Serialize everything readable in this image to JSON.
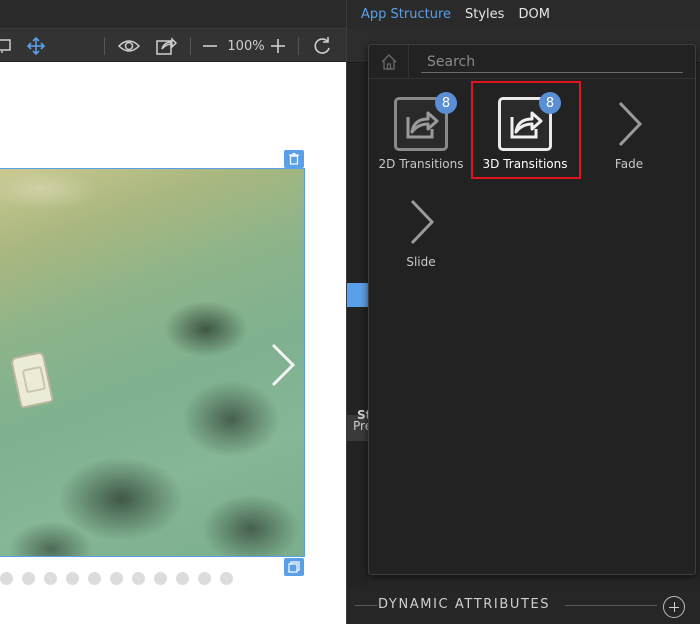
{
  "toolbar": {
    "zoom_level": "100%"
  },
  "carousel": {
    "dot_count": 11
  },
  "right_panel": {
    "tabs": [
      {
        "label": "App Structure",
        "active": true
      },
      {
        "label": "Styles",
        "active": false
      },
      {
        "label": "DOM",
        "active": false
      }
    ],
    "pre_tab_label": "Pre",
    "st_label": "St",
    "dynamic_attributes_label": "DYNAMIC ATTRIBUTES"
  },
  "popup": {
    "search_placeholder": "Search",
    "items": [
      {
        "label": "2D Transitions",
        "badge": "8",
        "icon": "share-arrow-icon"
      },
      {
        "label": "3D Transitions",
        "badge": "8",
        "icon": "share-arrow-icon",
        "selected": true
      },
      {
        "label": "Fade",
        "icon": "chevron-right-icon"
      },
      {
        "label": "Slide",
        "icon": "chevron-right-icon"
      }
    ]
  },
  "colors": {
    "accent": "#5aa0e8",
    "badge": "#5a8fd6",
    "highlight": "#e0141e",
    "panel_bg": "#222222"
  }
}
